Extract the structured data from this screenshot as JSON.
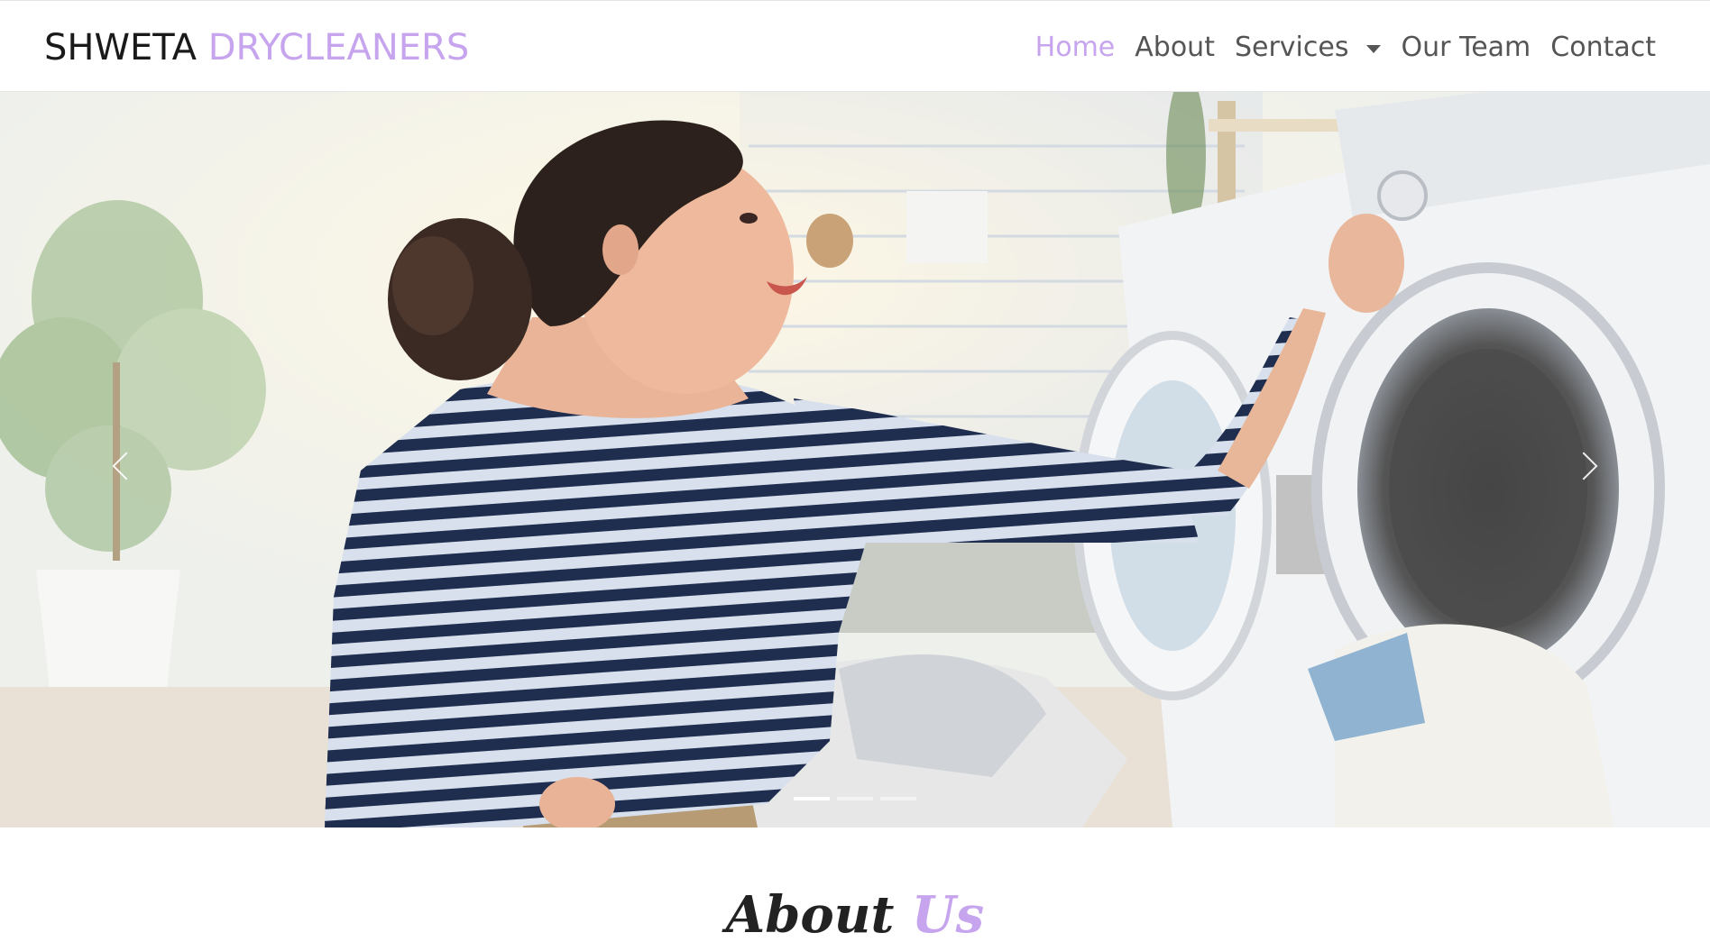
{
  "navbar": {
    "brand_part1": "SHWETA",
    "brand_part2": "DRYCLEANERS",
    "links": [
      {
        "label": "Home",
        "active": true
      },
      {
        "label": "About",
        "active": false
      },
      {
        "label": "Services",
        "active": false,
        "dropdown": true
      },
      {
        "label": "Our Team",
        "active": false
      },
      {
        "label": "Contact",
        "active": false
      }
    ]
  },
  "carousel": {
    "slide_count": 3,
    "active_slide": 1,
    "prev_icon": "chevron-left-icon",
    "next_icon": "chevron-right-icon"
  },
  "about": {
    "heading_part1": "About",
    "heading_part2": "Us"
  },
  "colors": {
    "accent": "#c6a4ee",
    "nav_text": "#555555",
    "brand_text": "#1a1a1a"
  }
}
